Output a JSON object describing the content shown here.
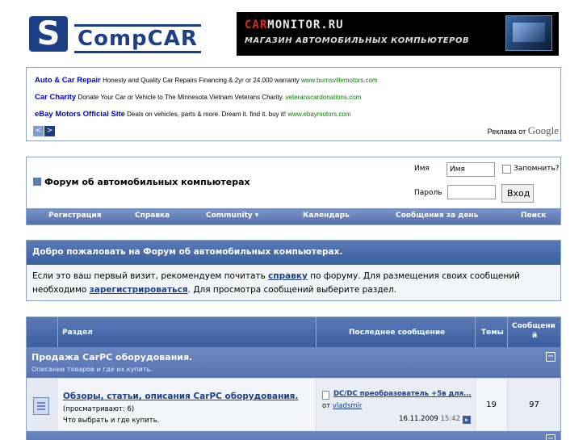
{
  "logo": {
    "letter": "S",
    "text": "CompCAR"
  },
  "banner": {
    "title_red": "CAR",
    "title_rest": "MONITOR.RU",
    "subtitle": "МАГАЗИН АВТОМОБИЛЬНЫХ КОМПЬЮТЕРОВ"
  },
  "ads": {
    "items": [
      {
        "title": "Auto & Car Repair",
        "text": "Honesty and Quality Car Repairs Financing & 2yr or 24.000 warranty",
        "url": "www.burnsvillemotors.com"
      },
      {
        "title": "Car Charity",
        "text": "Donate Your Car or Vehicle to The Minnesota Vietnam Veterans Charity.",
        "url": "veteranscardonations.com"
      },
      {
        "title": "eBay Motors Official Site",
        "text": "Deals on vehicles, parts & more. Dream it. find it. buy it!",
        "url": "www.ebaymotors.com"
      }
    ],
    "prev": "<",
    "next": ">",
    "by_label": "Реклама от",
    "by_brand": "Google"
  },
  "forum": {
    "title": "Форум об автомобильных компьютерах",
    "login": {
      "name_label": "Имя",
      "name_value": "Имя",
      "remember_label": "Запомнить?",
      "password_label": "Пароль",
      "submit_label": "Вход"
    },
    "nav": [
      "Регистрация",
      "Справка",
      "Community ▾",
      "Календарь",
      "Сообщения за день",
      "Поиск"
    ]
  },
  "welcome": {
    "heading": "Добро пожаловать на Форум об автомобильных компьютерах.",
    "p1": "Если это ваш первый визит, рекомендуем почитать ",
    "link_help": "справку",
    "p2": " по форуму. Для размещения своих сообщений необходимо ",
    "link_register": "зарегистрироваться",
    "p3": ". Для просмотра сообщений выберите раздел."
  },
  "table": {
    "headers": {
      "section": "Раздел",
      "last_post": "Последнее сообщение",
      "topics": "Темы",
      "posts_line1": "Сообщени",
      "posts_line2": "й"
    },
    "category": {
      "title": "Продажа CarPC оборудования.",
      "desc": "Описание товаров и где их купить.",
      "collapse": "−"
    },
    "rows": [
      {
        "title": "Обзоры, статьи, описания CarPC оборудования.",
        "viewers": "(просматривают: 6)",
        "desc": "Что выбрать и где купить.",
        "last_title": "DC/DC преобразователь +5в для...",
        "from_label": "от",
        "last_author": "vladsmir",
        "last_date": "16.11.2009",
        "last_time": "15:42",
        "topics": "19",
        "posts": "97"
      }
    ],
    "next_category_collapse": "−"
  }
}
